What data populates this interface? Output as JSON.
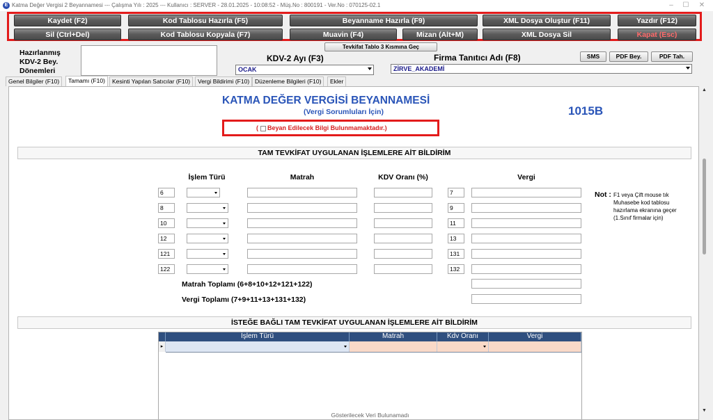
{
  "window": {
    "title": "Katma Değer Vergisi 2 Beyannamesi  ---  Çalışma Yılı : 2025  ---  Kullanıcı : SERVER - 28.01.2025 - 10:08:52 - Müş.No : 800191 - Ver.No : 070125-02.1",
    "app_icon": "E",
    "minimize": "–",
    "maximize": "☐",
    "close": "✕"
  },
  "toolbar": {
    "row1": [
      "Kaydet (F2)",
      "Kod Tablosu Hazırla (F5)",
      "Beyanname Hazırla (F9)",
      "XML Dosya Oluştur (F11)",
      "Yazdır (F12)"
    ],
    "row2": [
      "Sil (Ctrl+Del)",
      "Kod Tablosu Kopyala (F7)",
      "Muavin (F4)",
      "Mizan (Alt+M)",
      "XML Dosya Sil",
      "Kapat (Esc)"
    ]
  },
  "header": {
    "tevkifat_btn": "Tevkifat Tablo 3 Kısmına Geç",
    "hazirlanmis_label": "Hazırlanmış KDV-2 Bey. Dönemleri",
    "kdv_ay_label": "KDV-2 Ayı (F3)",
    "kdv_ay_value": "OCAK",
    "firma_label": "Firma Tanıtıcı Adı (F8)",
    "firma_value": "ZİRVE_AKADEMİ",
    "sms": "SMS",
    "pdf_bey": "PDF Bey.",
    "pdf_tah": "PDF Tah."
  },
  "tabs": [
    "Genel Bilgiler (F10)",
    "Tamamı (F10)",
    "Kesinti Yapılan Satıcılar (F10)",
    "Vergi Bildirimi (F10)",
    "Düzenleme Bilgileri (F10)",
    "Ekler"
  ],
  "form": {
    "title": "KATMA  DEĞER VERGİSİ BEYANNAMESİ",
    "subtitle": "(Vergi Sorumluları İçin)",
    "code": "1015B",
    "beyan_paren_open": "(",
    "beyan_paren_close": ".)",
    "beyan_text": "Beyan Edilecek Bilgi Bulunmamaktadır",
    "section1": "TAM TEVKİFAT UYGULANAN İŞLEMLERE AİT BİLDİRİM",
    "col_islem": "İşlem Türü",
    "col_matrah": "Matrah",
    "col_kdv": "KDV Oranı (%)",
    "col_vergi": "Vergi",
    "rows": [
      {
        "left": "6",
        "right": "7"
      },
      {
        "left": "8",
        "right": "9"
      },
      {
        "left": "10",
        "right": "11"
      },
      {
        "left": "12",
        "right": "13"
      },
      {
        "left": "121",
        "right": "131"
      },
      {
        "left": "122",
        "right": "132"
      }
    ],
    "matrah_toplam": "Matrah Toplamı (6+8+10+12+121+122)",
    "vergi_toplam": "Vergi Toplamı (7+9+11+13+131+132)",
    "note_label": "Not :",
    "note_text": "F1 veya Çift mouse tık Muhasebe kod tablosu hazırlama ekranına geçer (1.Sınıf firmalar için)",
    "section2": "İSTEĞE BAĞLI TAM TEVKİFAT UYGULANAN İŞLEMLERE AİT BİLDİRİM",
    "grid_cols": [
      "İşlem Türü",
      "Matrah",
      "Kdv Oranı",
      "Vergi"
    ],
    "grid_empty": "Gösterilecek Veri Bulunamadı"
  },
  "colors": {
    "accent": "#2a55b8",
    "highlight": "#e31b1b",
    "grid_header": "#2f4f7f"
  }
}
